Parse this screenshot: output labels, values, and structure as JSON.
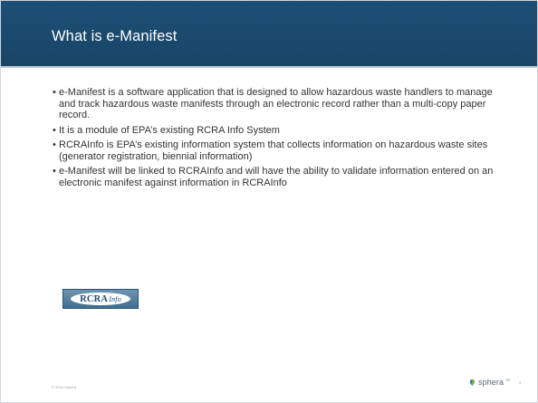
{
  "slide": {
    "title": "What is e-Manifest",
    "bullets": [
      "e-Manifest is a software application that is designed to allow hazardous waste handlers to manage and track hazardous waste manifests through an electronic record rather than a multi-copy paper record.",
      "It is a module of EPA’s existing RCRA Info System",
      "RCRAInfo is EPA’s existing information system that collects information on hazardous waste sites (generator registration, biennial information)",
      "e-Manifest will be linked to RCRAInfo and will have the ability to validate information entered on an electronic manifest against information in RCRAInfo"
    ]
  },
  "logo": {
    "main": "RCRA",
    "sub": "Info"
  },
  "footer": {
    "copyright": "© 2016 Sphera",
    "brand": "sphera",
    "trademark": "™",
    "page_number": "3"
  },
  "colors": {
    "header": "#1d4f76",
    "text": "#333333",
    "logo_blue": "#3f6f92",
    "sphera_green": "#6ab04c",
    "sphera_blue": "#2a6db0"
  },
  "icons": {
    "brand_mark": "sphera-leaf-icon"
  }
}
